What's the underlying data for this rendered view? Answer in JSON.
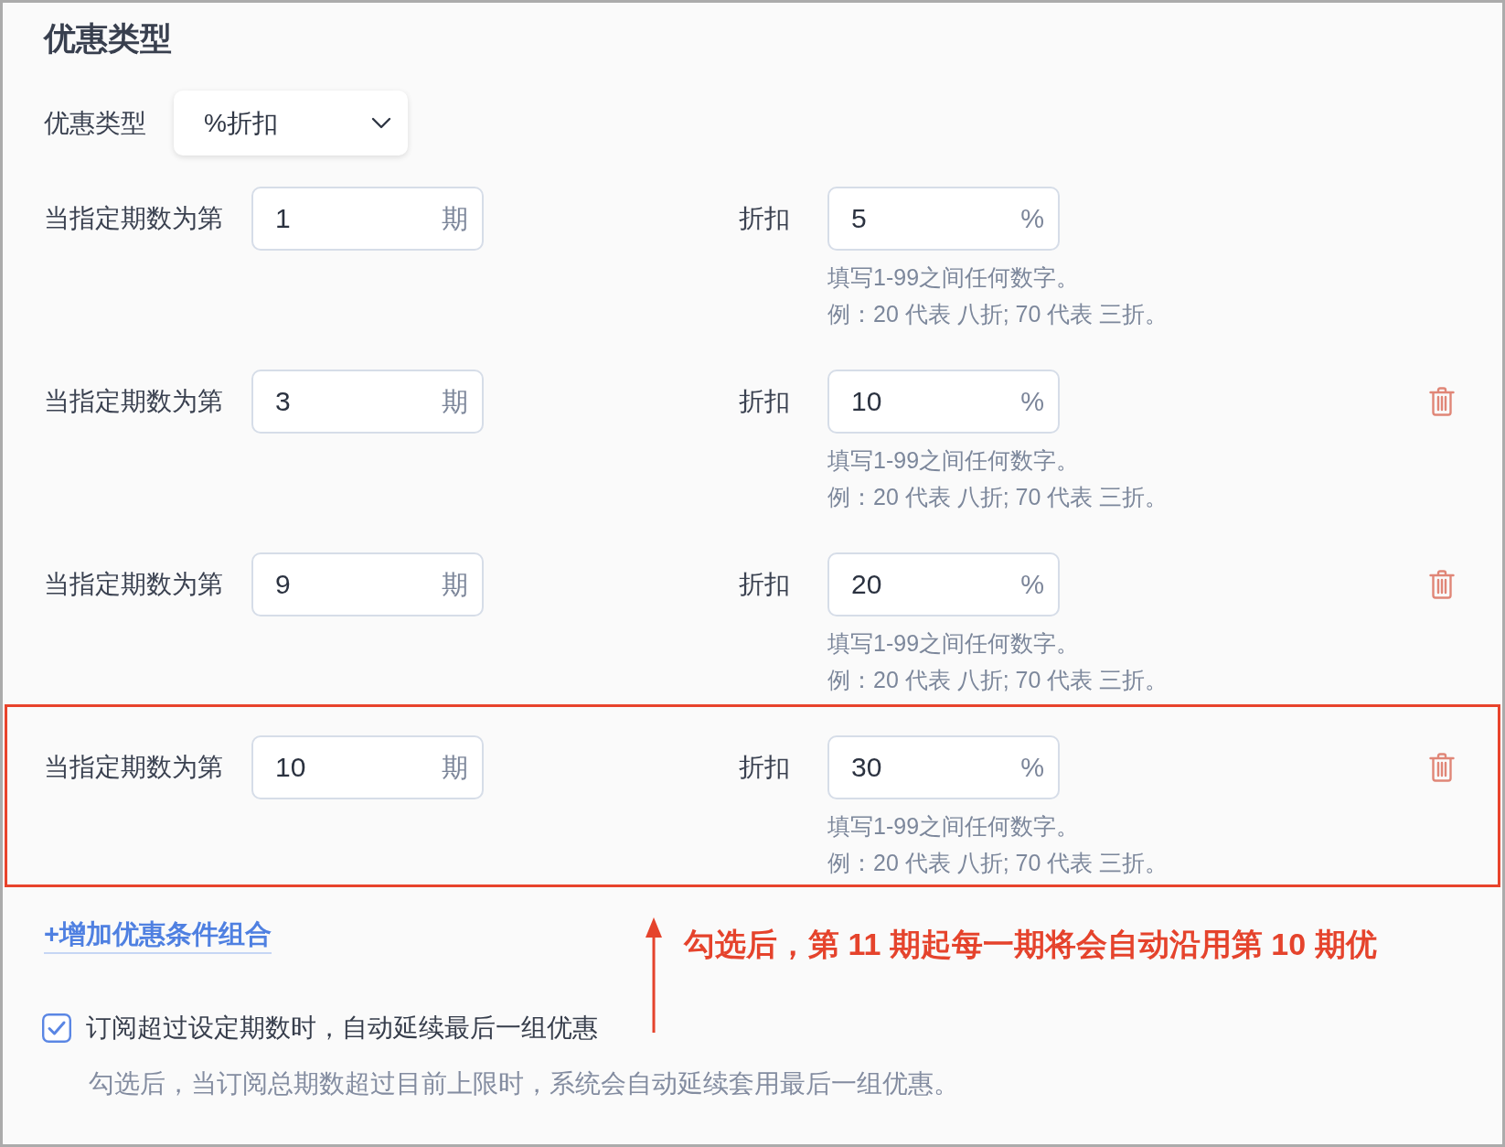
{
  "section": {
    "title": "优惠类型"
  },
  "discount_type": {
    "label": "优惠类型",
    "value": "%折扣"
  },
  "rules": [
    {
      "period_label": "当指定期数为第",
      "period": "1",
      "period_unit": "期",
      "discount_label": "折扣",
      "discount": "5",
      "discount_unit": "%",
      "hint_lines": [
        "填写1-99之间任何数字。",
        "例：20 代表 八折; 70 代表 三折。"
      ],
      "deletable": false,
      "highlighted": false
    },
    {
      "period_label": "当指定期数为第",
      "period": "3",
      "period_unit": "期",
      "discount_label": "折扣",
      "discount": "10",
      "discount_unit": "%",
      "hint_lines": [
        "填写1-99之间任何数字。",
        "例：20 代表 八折; 70 代表 三折。"
      ],
      "deletable": true,
      "highlighted": false
    },
    {
      "period_label": "当指定期数为第",
      "period": "9",
      "period_unit": "期",
      "discount_label": "折扣",
      "discount": "20",
      "discount_unit": "%",
      "hint_lines": [
        "填写1-99之间任何数字。",
        "例：20 代表 八折; 70 代表 三折。"
      ],
      "deletable": true,
      "highlighted": false
    },
    {
      "period_label": "当指定期数为第",
      "period": "10",
      "period_unit": "期",
      "discount_label": "折扣",
      "discount": "30",
      "discount_unit": "%",
      "hint_lines": [
        "填写1-99之间任何数字。",
        "例：20 代表 八折; 70 代表 三折。"
      ],
      "deletable": true,
      "highlighted": true
    }
  ],
  "add_link": "+增加优惠条件组合",
  "annotation": {
    "text": "勾选后，第 11 期起每一期将会自动沿用第 10 期优"
  },
  "auto_extend": {
    "checked": true,
    "label": "订阅超过设定期数时，自动延续最后一组优惠",
    "hint": "勾选后，当订阅总期数超过目前上限时，系统会自动延续套用最后一组优惠。"
  }
}
